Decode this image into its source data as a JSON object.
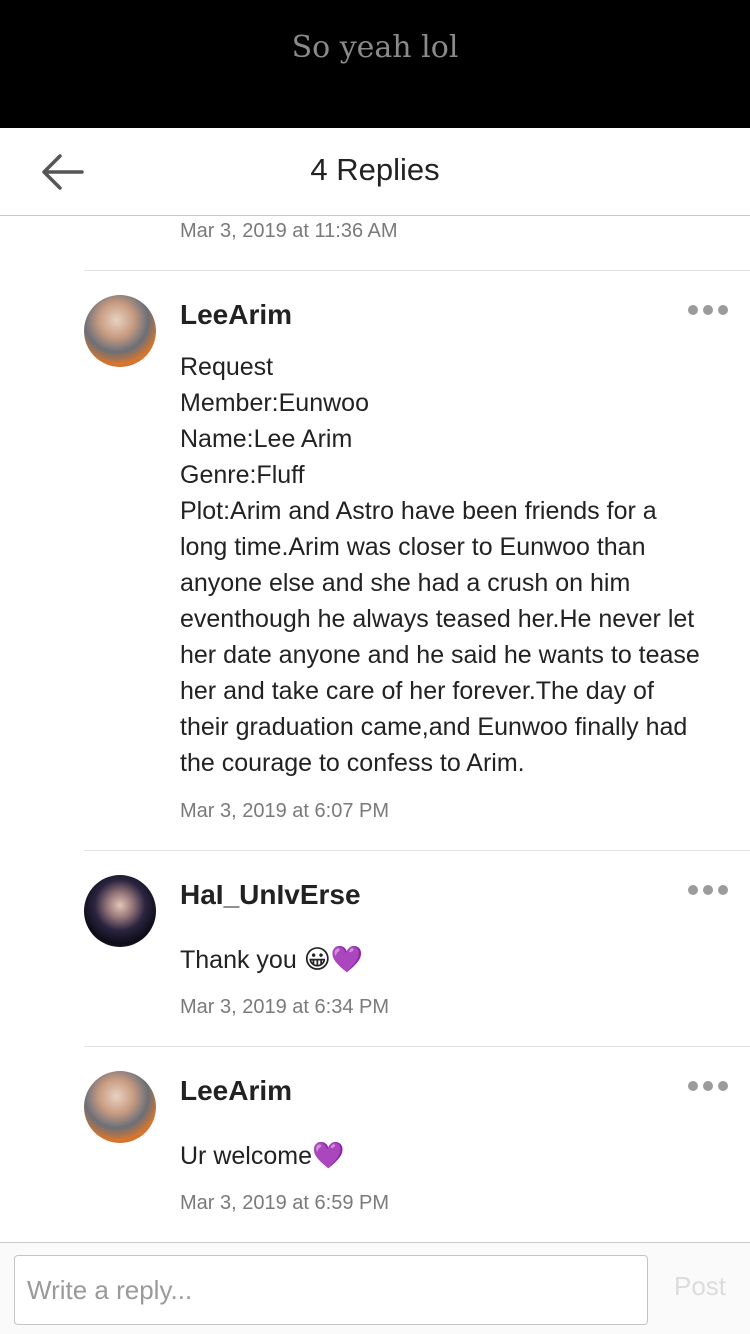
{
  "banner": {
    "text": "So yeah lol"
  },
  "header": {
    "title": "4 Replies",
    "back_icon": "arrow-left-icon"
  },
  "previous_timestamp": "Mar 3, 2019 at 11:36 AM",
  "replies": [
    {
      "username": "LeeArim",
      "lines": [
        "Request",
        "Member:Eunwoo",
        "Name:Lee Arim",
        "Genre:Fluff",
        "Plot:Arim and Astro have been friends for a",
        "long time.Arim was closer to Eunwoo than",
        "anyone else and she had a crush on him",
        "eventhough he always teased her.He never let",
        "her date anyone and he said he wants to tease",
        "her and take care of her forever.The day of",
        "their graduation came,and Eunwoo finally had",
        "the courage to confess to Arim."
      ],
      "timestamp": "Mar 3, 2019 at 6:07 PM"
    },
    {
      "username": "HaI_UnIvErse",
      "text": "Thank you",
      "emoji": "😀💜",
      "timestamp": "Mar 3, 2019 at 6:34 PM"
    },
    {
      "username": "LeeArim",
      "text": "Ur welcome",
      "emoji": "💜",
      "timestamp": "Mar 3, 2019 at 6:59 PM"
    }
  ],
  "composer": {
    "placeholder": "Write a reply...",
    "post_label": "Post"
  },
  "colors": {
    "banner_bg": "#000000",
    "more_dots": "#9b9b9b",
    "post_disabled": "#dcdcdc"
  }
}
